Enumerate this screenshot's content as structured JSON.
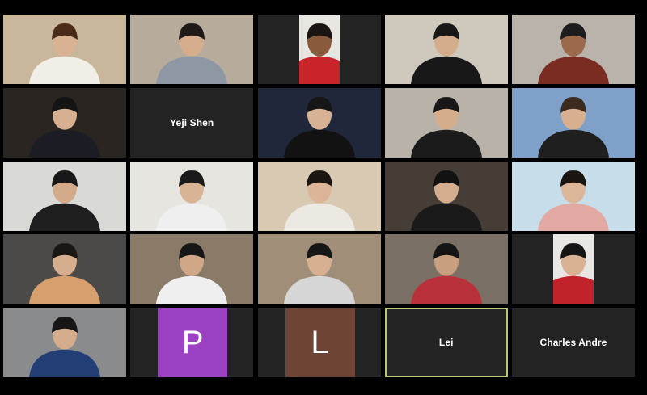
{
  "meeting": {
    "view": "gallery",
    "grid": "5x5",
    "active_speaker": "Lei"
  },
  "participants": [
    {
      "display": "video",
      "label": "",
      "icon": "person-peace-sign",
      "bg": "#c9b79b",
      "fg": "#f1eee7",
      "skin": "#d9b193",
      "hair": "#4a2a18"
    },
    {
      "display": "video",
      "label": "",
      "icon": "person-waving",
      "bg": "#b7ab9c",
      "fg": "#8d98a4",
      "skin": "#d6ae8e",
      "hair": "#1d1a18"
    },
    {
      "display": "video",
      "label": "",
      "icon": "person-portrait",
      "bg": "#e8e6e1",
      "fg": "#c8242a",
      "skin": "#8a5a3c",
      "hair": "#1a1412"
    },
    {
      "display": "video",
      "label": "",
      "icon": "person-peace-sign",
      "bg": "#cfc8bd",
      "fg": "#181818",
      "skin": "#d3ad8c",
      "hair": "#1a1816"
    },
    {
      "display": "video",
      "label": "",
      "icon": "person-headphones",
      "bg": "#b9b3ac",
      "fg": "#7a2b22",
      "skin": "#9a6a4a",
      "hair": "#1d1d1d"
    },
    {
      "display": "video",
      "label": "",
      "icon": "person-peace-sign",
      "bg": "#2a2520",
      "fg": "#1c1c24",
      "skin": "#d6b091",
      "hair": "#141414"
    },
    {
      "display": "name",
      "label": "Yeji Shen",
      "icon": "",
      "bg": "#232323"
    },
    {
      "display": "video",
      "label": "",
      "icon": "person-peace-sign",
      "bg": "#20273a",
      "fg": "#121212",
      "skin": "#d8b294",
      "hair": "#161616"
    },
    {
      "display": "video",
      "label": "",
      "icon": "person-waving",
      "bg": "#b8b2a9",
      "fg": "#1b1b1b",
      "skin": "#d4ad8c",
      "hair": "#171717"
    },
    {
      "display": "video",
      "label": "",
      "icon": "person-campus-background",
      "bg": "#7fa0c8",
      "fg": "#1f1f1f",
      "skin": "#d8b090",
      "hair": "#3a2a20"
    },
    {
      "display": "video",
      "label": "",
      "icon": "person-peace-sign",
      "bg": "#d9d9d6",
      "fg": "#1e1e1e",
      "skin": "#d3ab8a",
      "hair": "#181818"
    },
    {
      "display": "video",
      "label": "",
      "icon": "person-peace-sign",
      "bg": "#e7e5e0",
      "fg": "#efefef",
      "skin": "#d8b394",
      "hair": "#1a1a1a"
    },
    {
      "display": "video",
      "label": "",
      "icon": "person-peace-sign",
      "bg": "#d8c9b2",
      "fg": "#ece8e2",
      "skin": "#dcb598",
      "hair": "#1c1612"
    },
    {
      "display": "video",
      "label": "",
      "icon": "person-ceiling-fan",
      "bg": "#463e36",
      "fg": "#1a1a1a",
      "skin": "#d5ae8f",
      "hair": "#121212"
    },
    {
      "display": "video",
      "label": "",
      "icon": "person-desert-background",
      "bg": "#c7dde9",
      "fg": "#e2a8a2",
      "skin": "#dbb698",
      "hair": "#1b1512"
    },
    {
      "display": "video",
      "label": "",
      "icon": "person-peace-sign",
      "bg": "#4c4a48",
      "fg": "#d7a06f",
      "skin": "#d6ae8e",
      "hair": "#1a1614"
    },
    {
      "display": "video",
      "label": "",
      "icon": "person-peace-sign",
      "bg": "#8a7a68",
      "fg": "#efefef",
      "skin": "#d0a888",
      "hair": "#171717"
    },
    {
      "display": "video",
      "label": "",
      "icon": "person-peace-sign",
      "bg": "#a08e78",
      "fg": "#d6d6d6",
      "skin": "#d7b091",
      "hair": "#161616"
    },
    {
      "display": "video",
      "label": "",
      "icon": "person-peace-sign",
      "bg": "#7a7066",
      "fg": "#b8313a",
      "skin": "#c99f80",
      "hair": "#141414"
    },
    {
      "display": "video",
      "label": "",
      "icon": "person-portrait",
      "bg": "#e9e7e3",
      "fg": "#c2232a",
      "skin": "#d8b293",
      "hair": "#151515"
    },
    {
      "display": "video",
      "label": "",
      "icon": "person-peace-sign",
      "bg": "#898b8d",
      "fg": "#223e74",
      "skin": "#d5ad8c",
      "hair": "#161616"
    },
    {
      "display": "avatar",
      "label": "",
      "initial": "P",
      "icon": "",
      "bg": "#232323",
      "avatar_color": "#9c41c2"
    },
    {
      "display": "avatar",
      "label": "",
      "initial": "L",
      "icon": "",
      "bg": "#232323",
      "avatar_color": "#6e4435"
    },
    {
      "display": "name",
      "label": "Lei",
      "icon": "",
      "bg": "#232323"
    },
    {
      "display": "name",
      "label": "Charles Andre",
      "icon": "",
      "bg": "#232323"
    }
  ]
}
